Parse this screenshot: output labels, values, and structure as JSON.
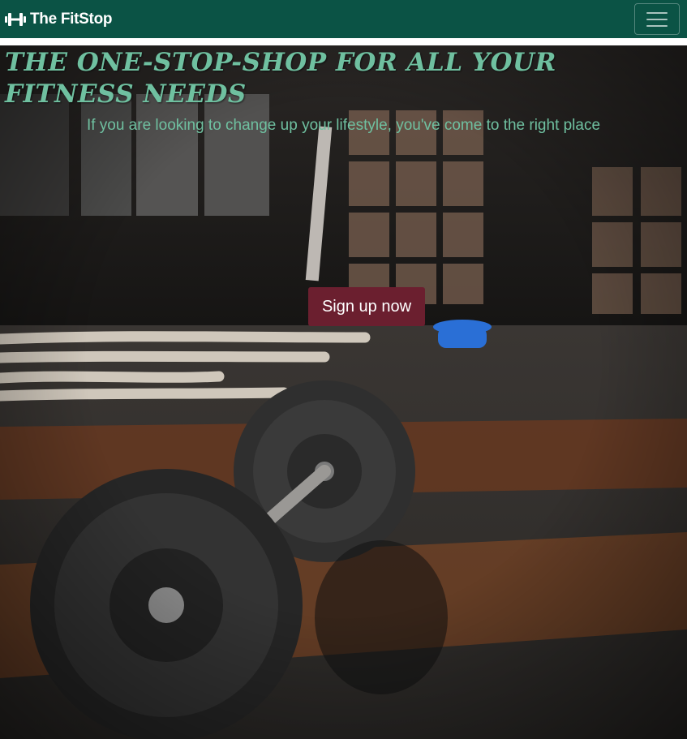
{
  "navbar": {
    "brand_icon": "dumbbell-icon",
    "brand_name": "The FitStop",
    "toggle_icon": "hamburger-menu-icon",
    "background_color": "#0b5345"
  },
  "hero": {
    "title": "THE ONE-STOP-SHOP FOR ALL YOUR FITNESS NEEDS",
    "subtitle": "If you are looking to change up your lifestyle, you've come to the right place",
    "cta_label": "Sign up now",
    "background_image": "gym floor with barbell, battle ropes and weight plates",
    "text_color": "#6fc0a0",
    "cta_color": "#6b1f2f"
  }
}
